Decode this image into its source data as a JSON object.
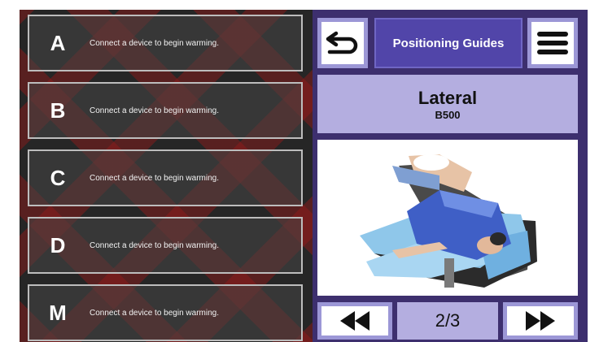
{
  "zones": [
    {
      "letter": "A",
      "message": "Connect a device to begin warming."
    },
    {
      "letter": "B",
      "message": "Connect a device to begin warming."
    },
    {
      "letter": "C",
      "message": "Connect a device to begin warming."
    },
    {
      "letter": "D",
      "message": "Connect a device to begin warming."
    },
    {
      "letter": "M",
      "message": "Connect a device to begin warming."
    }
  ],
  "header": {
    "title": "Positioning Guides",
    "back_icon": "back-arrow-icon",
    "menu_icon": "hamburger-menu-icon"
  },
  "guide": {
    "position_name": "Lateral",
    "model": "B500",
    "image_icon": "patient-lateral-position-image"
  },
  "pagination": {
    "page": "2/3",
    "prev_icon": "rewind-icon",
    "next_icon": "fast-forward-icon"
  },
  "colors": {
    "panel_background": "#3d2f6e",
    "title_button": "#5145a9",
    "light_lavender": "#b4aee0",
    "button_border": "#9c97d6",
    "pattern_red": "#961919"
  }
}
